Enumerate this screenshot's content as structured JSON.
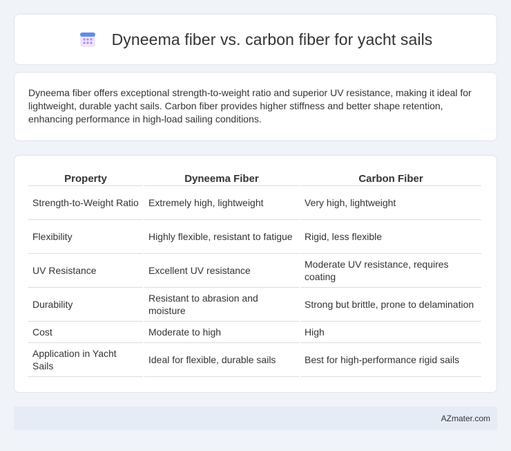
{
  "header": {
    "title": "Dyneema fiber vs. carbon fiber for yacht sails",
    "icon": "calendar-icon",
    "icon_colors": {
      "top": "#5b8def",
      "grid": "#c9a5f0",
      "base": "#e9e3fb"
    }
  },
  "summary": {
    "text": "Dyneema fiber offers exceptional strength-to-weight ratio and superior UV resistance, making it ideal for lightweight, durable yacht sails. Carbon fiber provides higher stiffness and better shape retention, enhancing performance in high-load sailing conditions."
  },
  "table": {
    "headers": [
      "Property",
      "Dyneema Fiber",
      "Carbon Fiber"
    ],
    "rows": [
      [
        "Strength-to-Weight Ratio",
        "Extremely high, lightweight",
        "Very high, lightweight"
      ],
      [
        "Flexibility",
        "Highly flexible, resistant to fatigue",
        "Rigid, less flexible"
      ],
      [
        "UV Resistance",
        "Excellent UV resistance",
        "Moderate UV resistance, requires coating"
      ],
      [
        "Durability",
        "Resistant to abrasion and moisture",
        "Strong but brittle, prone to delamination"
      ],
      [
        "Cost",
        "Moderate to high",
        "High"
      ],
      [
        "Application in Yacht Sails",
        "Ideal for flexible, durable sails",
        "Best for high-performance rigid sails"
      ]
    ]
  },
  "footer": {
    "brand": "AZmater.com"
  }
}
